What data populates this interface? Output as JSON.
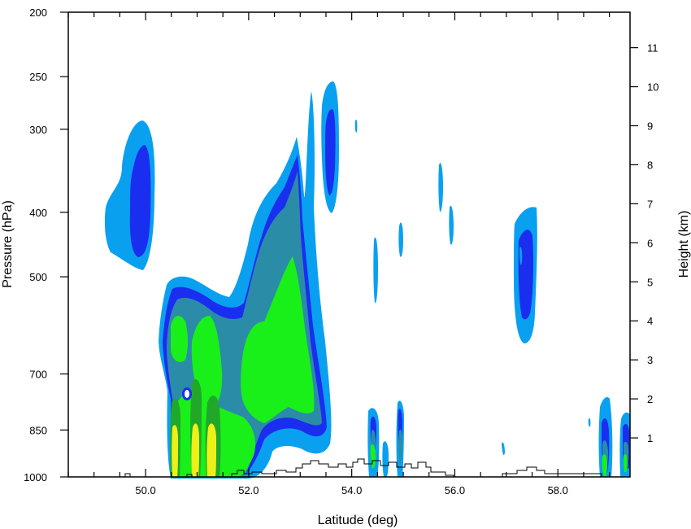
{
  "chart_data": {
    "type": "heatmap",
    "title": "",
    "xlabel": "Latitude (deg)",
    "ylabel": "Pressure (hPa)",
    "y2label": "Height (km)",
    "xlim": [
      48.5,
      59.4
    ],
    "ylim": [
      1000,
      200
    ],
    "y_scale": "log",
    "x_ticks": [
      "50.0",
      "52.0",
      "54.0",
      "56.0",
      "58.0"
    ],
    "y_ticks": [
      {
        "value": 1000,
        "label": "1000"
      },
      {
        "value": 850,
        "label": "850"
      },
      {
        "value": 700,
        "label": "700"
      },
      {
        "value": 500,
        "label": "500"
      },
      {
        "value": 400,
        "label": "400"
      },
      {
        "value": 300,
        "label": "300"
      },
      {
        "value": 250,
        "label": "250"
      },
      {
        "value": 200,
        "label": "200"
      }
    ],
    "y2_ticks": [
      "1",
      "2",
      "3",
      "4",
      "5",
      "6",
      "7",
      "8",
      "9",
      "10",
      "11"
    ],
    "contour_levels": [
      {
        "level": 1,
        "color": "#0aa0f0"
      },
      {
        "level": 2,
        "color": "#1a2ef0"
      },
      {
        "level": 3,
        "color": "#2b8ca8"
      },
      {
        "level": 4,
        "color": "#19f019"
      },
      {
        "level": 5,
        "color": "#21a82a"
      },
      {
        "level": 6,
        "color": "#f0f019"
      }
    ],
    "grid": false,
    "legend": "none"
  }
}
